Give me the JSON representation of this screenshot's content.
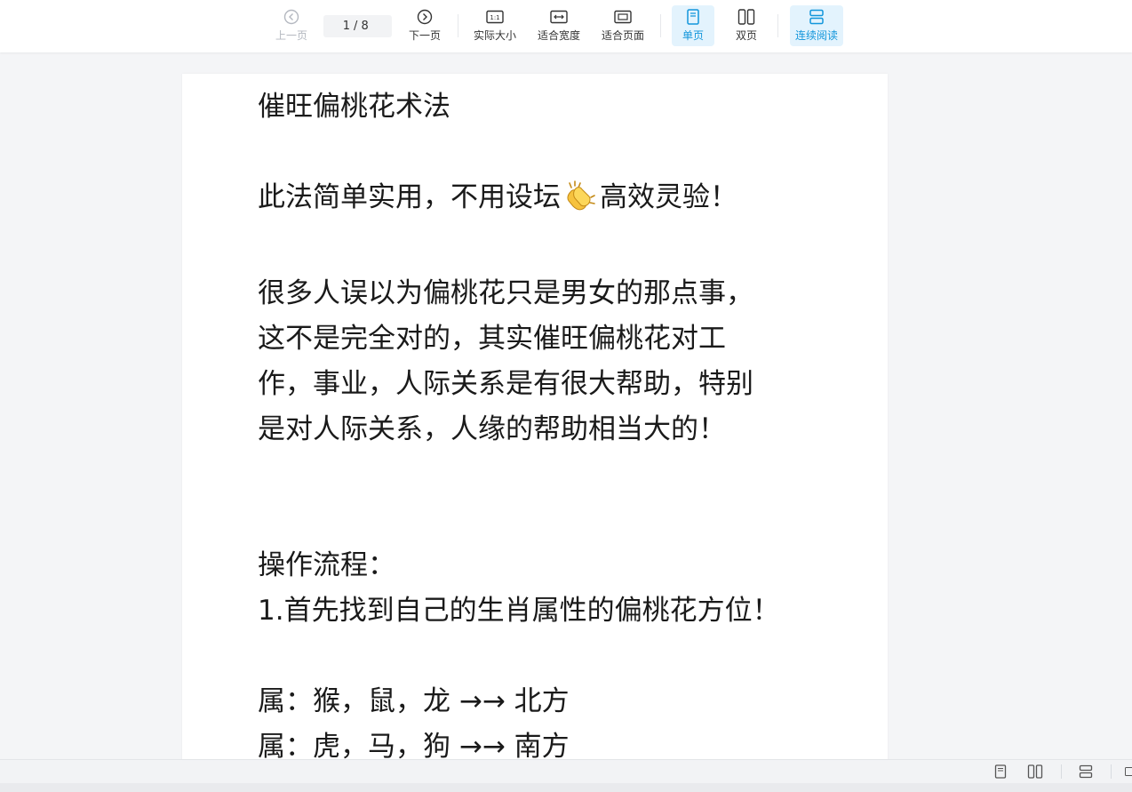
{
  "toolbar": {
    "prev_page": "上一页",
    "page_current": "1",
    "page_total": "/ 8",
    "next_page": "下一页",
    "actual_size": "实际大小",
    "fit_width": "适合宽度",
    "fit_page": "适合页面",
    "single_page": "单页",
    "double_page": "双页",
    "continuous": "连续阅读"
  },
  "document": {
    "title": "催旺偏桃花术法",
    "intro_before_emoji": "此法简单实用，不用设坛",
    "intro_emoji": "clapping-hands-icon",
    "intro_after_emoji": "高效灵验！",
    "para_lines": [
      "很多人误以为偏桃花只是男女的那点事，",
      "这不是完全对的，其实催旺偏桃花对工",
      "作，事业，人际关系是有很大帮助，特别",
      "是对人际关系，人缘的帮助相当大的！"
    ],
    "process_title": "操作流程：",
    "step1": "1.首先找到自己的生肖属性的偏桃花方位！",
    "zodiac_lines": [
      "属：猴，鼠，龙 →→ 北方",
      "属：虎，马，狗 →→ 南方"
    ]
  },
  "colors": {
    "accent": "#1296db",
    "active_bg": "#e3f3fd",
    "disabled": "#b4b8c0",
    "page_bg": "#f4f5f7"
  }
}
